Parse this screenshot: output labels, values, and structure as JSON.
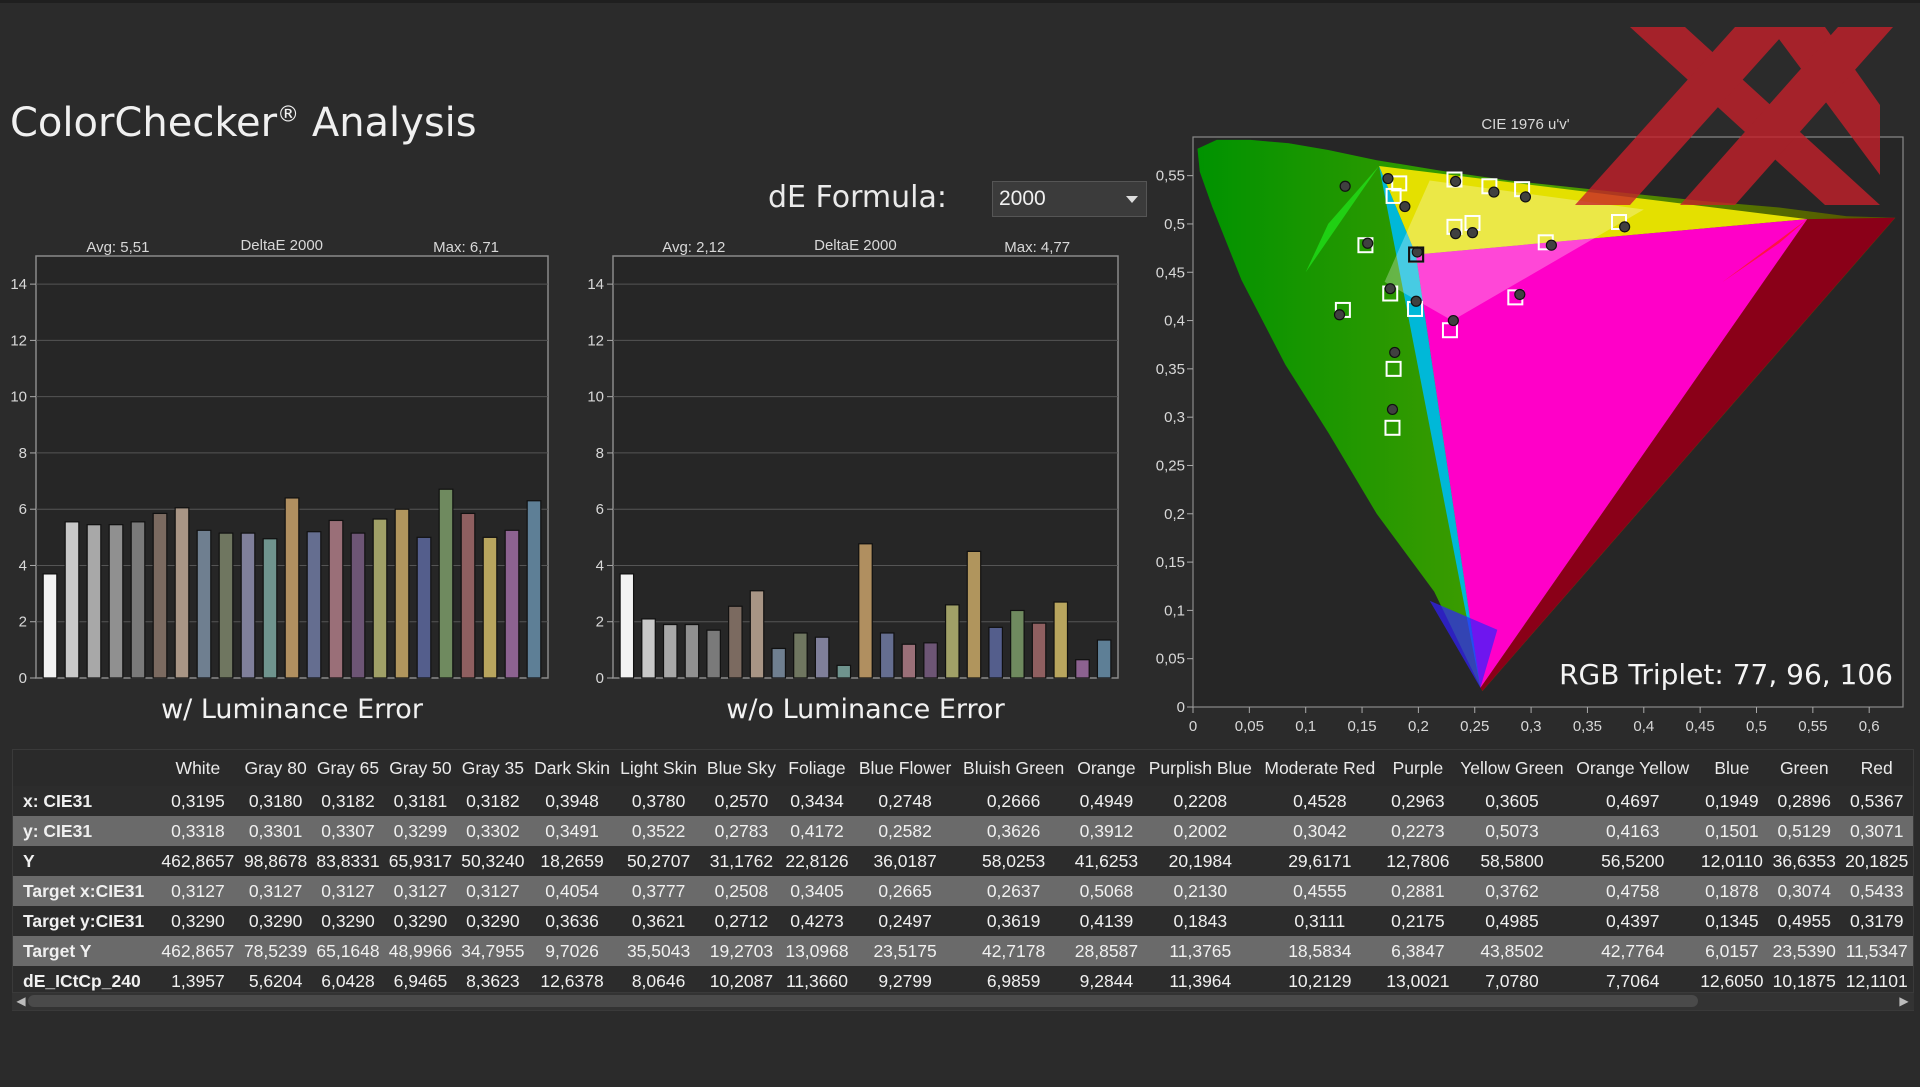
{
  "title": "ColorChecker",
  "title_mark": "®",
  "title_suffix": " Analysis",
  "de_formula": {
    "label": "dE Formula:",
    "value": "2000"
  },
  "chart_data": [
    {
      "type": "bar",
      "name": "w/ Luminance Error",
      "title": "DeltaE 2000",
      "avg_label": "Avg: 5,51",
      "max_label": "Max: 6,71",
      "xlabel": "w/ Luminance Error",
      "ylim": [
        0,
        15
      ],
      "yticks": [
        0,
        2,
        4,
        6,
        8,
        10,
        12,
        14
      ],
      "values": [
        3.7,
        5.55,
        5.45,
        5.45,
        5.55,
        5.85,
        6.05,
        5.25,
        5.15,
        5.15,
        4.95,
        6.4,
        5.2,
        5.6,
        5.15,
        5.65,
        6.0,
        5.0,
        6.71,
        5.85,
        5.0,
        5.25,
        6.3
      ],
      "colors": [
        "#f2f2f2",
        "#c8c8c8",
        "#a8a8a8",
        "#909090",
        "#7a7a7a",
        "#7b6a60",
        "#a89585",
        "#6f7f90",
        "#6f7660",
        "#7f7f9a",
        "#6f948e",
        "#b08f60",
        "#656e90",
        "#9a6f78",
        "#6d5575",
        "#a0a067",
        "#b0955d",
        "#545e8c",
        "#6f8a5f",
        "#8f5f60",
        "#b8a55e",
        "#8c6290",
        "#5e7f96"
      ]
    },
    {
      "type": "bar",
      "name": "w/o Luminance Error",
      "title": "DeltaE 2000",
      "avg_label": "Avg: 2,12",
      "max_label": "Max: 4,77",
      "xlabel": "w/o Luminance Error",
      "ylim": [
        0,
        15
      ],
      "yticks": [
        0,
        2,
        4,
        6,
        8,
        10,
        12,
        14
      ],
      "values": [
        3.7,
        2.1,
        1.9,
        1.9,
        1.7,
        2.55,
        3.1,
        1.05,
        1.6,
        1.45,
        0.45,
        4.77,
        1.6,
        1.2,
        1.25,
        2.6,
        4.5,
        1.8,
        2.4,
        1.95,
        2.7,
        0.65,
        1.35
      ],
      "colors": [
        "#f2f2f2",
        "#c8c8c8",
        "#a8a8a8",
        "#909090",
        "#7a7a7a",
        "#7b6a60",
        "#a89585",
        "#6f7f90",
        "#6f7660",
        "#7f7f9a",
        "#6f948e",
        "#b08f60",
        "#656e90",
        "#9a6f78",
        "#6d5575",
        "#a0a067",
        "#b0955d",
        "#545e8c",
        "#6f8a5f",
        "#8f5f60",
        "#b8a55e",
        "#8c6290",
        "#5e7f96"
      ]
    },
    {
      "type": "scatter",
      "title": "CIE 1976 u'v'",
      "xlim": [
        0,
        0.63
      ],
      "ylim": [
        0,
        0.59
      ],
      "xticks": [
        "0",
        "0,05",
        "0,1",
        "0,15",
        "0,2",
        "0,25",
        "0,3",
        "0,35",
        "0,4",
        "0,45",
        "0,5",
        "0,55",
        "0,6"
      ],
      "yticks": [
        "0",
        "0,05",
        "0,1",
        "0,15",
        "0,2",
        "0,25",
        "0,3",
        "0,35",
        "0,4",
        "0,45",
        "0,5",
        "0,55"
      ],
      "gamut": {
        "red": [
          0.545,
          0.505
        ],
        "green": [
          0.165,
          0.56
        ],
        "blue": [
          0.255,
          0.02
        ],
        "white": [
          0.1978,
          0.4683
        ]
      },
      "targets": [
        [
          0.178,
          0.529
        ],
        [
          0.183,
          0.542
        ],
        [
          0.232,
          0.546
        ],
        [
          0.263,
          0.539
        ],
        [
          0.292,
          0.536
        ],
        [
          0.232,
          0.497
        ],
        [
          0.248,
          0.501
        ],
        [
          0.313,
          0.481
        ],
        [
          0.378,
          0.502
        ],
        [
          0.153,
          0.478
        ],
        [
          0.198,
          0.468
        ],
        [
          0.133,
          0.411
        ],
        [
          0.175,
          0.428
        ],
        [
          0.197,
          0.412
        ],
        [
          0.228,
          0.39
        ],
        [
          0.286,
          0.424
        ],
        [
          0.178,
          0.35
        ],
        [
          0.177,
          0.289
        ]
      ],
      "measured": [
        [
          0.135,
          0.539
        ],
        [
          0.173,
          0.547
        ],
        [
          0.188,
          0.518
        ],
        [
          0.233,
          0.544
        ],
        [
          0.267,
          0.533
        ],
        [
          0.295,
          0.528
        ],
        [
          0.233,
          0.49
        ],
        [
          0.248,
          0.491
        ],
        [
          0.318,
          0.478
        ],
        [
          0.383,
          0.497
        ],
        [
          0.155,
          0.48
        ],
        [
          0.199,
          0.471
        ],
        [
          0.13,
          0.406
        ],
        [
          0.175,
          0.433
        ],
        [
          0.198,
          0.42
        ],
        [
          0.231,
          0.4
        ],
        [
          0.29,
          0.427
        ],
        [
          0.179,
          0.367
        ],
        [
          0.177,
          0.308
        ]
      ],
      "rgb_triplet": "RGB Triplet: 77, 96, 106"
    }
  ],
  "table": {
    "columns": [
      "White",
      "Gray 80",
      "Gray 65",
      "Gray 50",
      "Gray 35",
      "Dark Skin",
      "Light Skin",
      "Blue Sky",
      "Foliage",
      "Blue Flower",
      "Bluish Green",
      "Orange",
      "Purplish Blue",
      "Moderate Red",
      "Purple",
      "Yellow Green",
      "Orange Yellow",
      "Blue",
      "Green",
      "Red"
    ],
    "rows": [
      {
        "label": "x: CIE31",
        "values": [
          "0,3195",
          "0,3180",
          "0,3182",
          "0,3181",
          "0,3182",
          "0,3948",
          "0,3780",
          "0,2570",
          "0,3434",
          "0,2748",
          "0,2666",
          "0,4949",
          "0,2208",
          "0,4528",
          "0,2963",
          "0,3605",
          "0,4697",
          "0,1949",
          "0,2896",
          "0,5367"
        ]
      },
      {
        "label": "y: CIE31",
        "values": [
          "0,3318",
          "0,3301",
          "0,3307",
          "0,3299",
          "0,3302",
          "0,3491",
          "0,3522",
          "0,2783",
          "0,4172",
          "0,2582",
          "0,3626",
          "0,3912",
          "0,2002",
          "0,3042",
          "0,2273",
          "0,5073",
          "0,4163",
          "0,1501",
          "0,5129",
          "0,3071"
        ]
      },
      {
        "label": "Y",
        "values": [
          "462,8657",
          "98,8678",
          "83,8331",
          "65,9317",
          "50,3240",
          "18,2659",
          "50,2707",
          "31,1762",
          "22,8126",
          "36,0187",
          "58,0253",
          "41,6253",
          "20,1984",
          "29,6171",
          "12,7806",
          "58,5800",
          "56,5200",
          "12,0110",
          "36,6353",
          "20,1825"
        ]
      },
      {
        "label": "Target x:CIE31",
        "values": [
          "0,3127",
          "0,3127",
          "0,3127",
          "0,3127",
          "0,3127",
          "0,4054",
          "0,3777",
          "0,2508",
          "0,3405",
          "0,2665",
          "0,2637",
          "0,5068",
          "0,2130",
          "0,4555",
          "0,2881",
          "0,3762",
          "0,4758",
          "0,1878",
          "0,3074",
          "0,5433"
        ]
      },
      {
        "label": "Target y:CIE31",
        "values": [
          "0,3290",
          "0,3290",
          "0,3290",
          "0,3290",
          "0,3290",
          "0,3636",
          "0,3621",
          "0,2712",
          "0,4273",
          "0,2497",
          "0,3619",
          "0,4139",
          "0,1843",
          "0,3111",
          "0,2175",
          "0,4985",
          "0,4397",
          "0,1345",
          "0,4955",
          "0,3179"
        ]
      },
      {
        "label": "Target Y",
        "values": [
          "462,8657",
          "78,5239",
          "65,1648",
          "48,9966",
          "34,7955",
          "9,7026",
          "35,5043",
          "19,2703",
          "13,0968",
          "23,5175",
          "42,7178",
          "28,8587",
          "11,3765",
          "18,5834",
          "6,3847",
          "43,8502",
          "42,7764",
          "6,0157",
          "23,5390",
          "11,5347"
        ]
      },
      {
        "label": "dE_ICtCp_240",
        "values": [
          "1,3957",
          "5,6204",
          "6,0428",
          "6,9465",
          "8,3623",
          "12,6378",
          "8,0646",
          "10,2087",
          "11,3660",
          "9,2799",
          "6,9859",
          "9,2844",
          "11,3964",
          "10,2129",
          "13,0021",
          "7,0780",
          "7,7064",
          "12,6050",
          "10,1875",
          "12,1101"
        ]
      }
    ]
  },
  "icons": {
    "dropdown": "chevron-down-icon",
    "logo": "xx-logo-icon",
    "scroll_left": "arrow-left-icon",
    "scroll_right": "arrow-right-icon"
  },
  "colors": {
    "background": "#2b2b2b",
    "plot_background": "#252525",
    "logo": "#c8202a"
  }
}
